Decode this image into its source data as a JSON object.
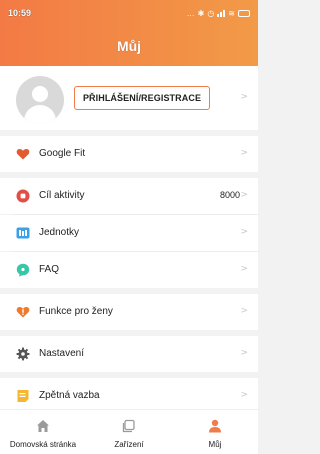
{
  "status": {
    "time": "10:59"
  },
  "header": {
    "title": "Můj"
  },
  "profile": {
    "login_label": "PŘIHLÁŠENÍ/REGISTRACE"
  },
  "menu": {
    "google_fit": "Google Fit",
    "activity_goal": "Cíl aktivity",
    "activity_goal_value": "8000",
    "units": "Jednotky",
    "faq": "FAQ",
    "women": "Funkce pro ženy",
    "settings": "Nastavení",
    "feedback": "Zpětná vazba"
  },
  "tabs": {
    "home": "Domovská stránka",
    "devices": "Zařízení",
    "mine": "Můj"
  },
  "colors": {
    "accent": "#f07c4a",
    "heart": "#e25b2f",
    "goal": "#e24d44",
    "units": "#3aa0e8",
    "faq": "#36c7a8",
    "women": "#ef7a2e",
    "settings": "#555555",
    "feedback": "#f5b731"
  }
}
